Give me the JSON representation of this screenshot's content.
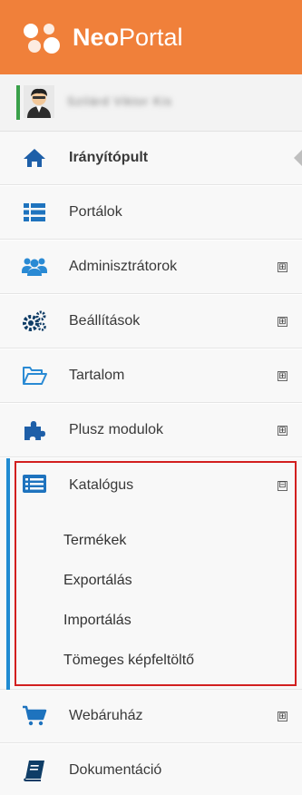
{
  "brand": {
    "name_bold": "Neo",
    "name_regular": "Portal",
    "bg_color": "#f0803a"
  },
  "user": {
    "name": "Szilárd Viktor Kis"
  },
  "menu": {
    "dashboard": {
      "label": "Irányítópult",
      "icon": "home-icon",
      "color": "#1e5fa8"
    },
    "portals": {
      "label": "Portálok",
      "icon": "list-icon",
      "color": "#1e73be"
    },
    "admins": {
      "label": "Adminisztrátorok",
      "icon": "users-icon",
      "expand": "⊞",
      "color": "#2a8ad4"
    },
    "settings": {
      "label": "Beállítások",
      "icon": "cogs-icon",
      "expand": "⊞",
      "color": "#0f3d66"
    },
    "content": {
      "label": "Tartalom",
      "icon": "folder-open-icon",
      "expand": "⊞",
      "color": "#2a8ad4"
    },
    "modules": {
      "label": "Plusz modulok",
      "icon": "puzzle-icon",
      "expand": "⊞",
      "color": "#1e5fa8"
    },
    "catalog": {
      "label": "Katalógus",
      "icon": "list-alt-icon",
      "collapse": "⊟",
      "color": "#1e73be",
      "children": [
        {
          "label": "Termékek"
        },
        {
          "label": "Exportálás"
        },
        {
          "label": "Importálás"
        },
        {
          "label": "Tömeges képfeltöltő"
        }
      ]
    },
    "shop": {
      "label": "Webáruház",
      "icon": "cart-icon",
      "expand": "⊞",
      "color": "#1e73be"
    },
    "docs": {
      "label": "Dokumentáció",
      "icon": "book-icon",
      "color": "#0f3d66"
    }
  }
}
